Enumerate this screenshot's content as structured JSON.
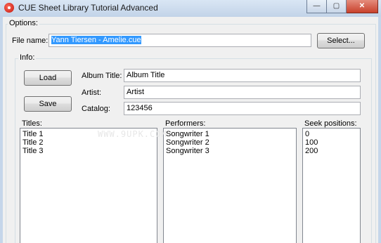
{
  "window": {
    "title": "CUE Sheet Library Tutorial Advanced",
    "minimize": "—",
    "maximize": "▢",
    "close": "✕"
  },
  "options": {
    "legend": "Options:",
    "file_name_label": "File name:",
    "file_name_value": "Yann Tiersen - Amelie.cue",
    "select_button": "Select..."
  },
  "info": {
    "legend": "Info:",
    "load_button": "Load",
    "save_button": "Save",
    "album_title_label": "Album Title:",
    "album_title_value": "Album Title",
    "artist_label": "Artist:",
    "artist_value": "Artist",
    "catalog_label": "Catalog:",
    "catalog_value": "123456"
  },
  "titles": {
    "label": "Titles:",
    "items": [
      "Title 1",
      "Title 2",
      "Title 3"
    ]
  },
  "performers": {
    "label": "Performers:",
    "items": [
      "Songwriter 1",
      "Songwriter 2",
      "Songwriter 3"
    ]
  },
  "seek_positions": {
    "label": "Seek positions:",
    "items": [
      "0",
      "100",
      "200"
    ]
  },
  "watermark": "WWW.9UPK.COM"
}
